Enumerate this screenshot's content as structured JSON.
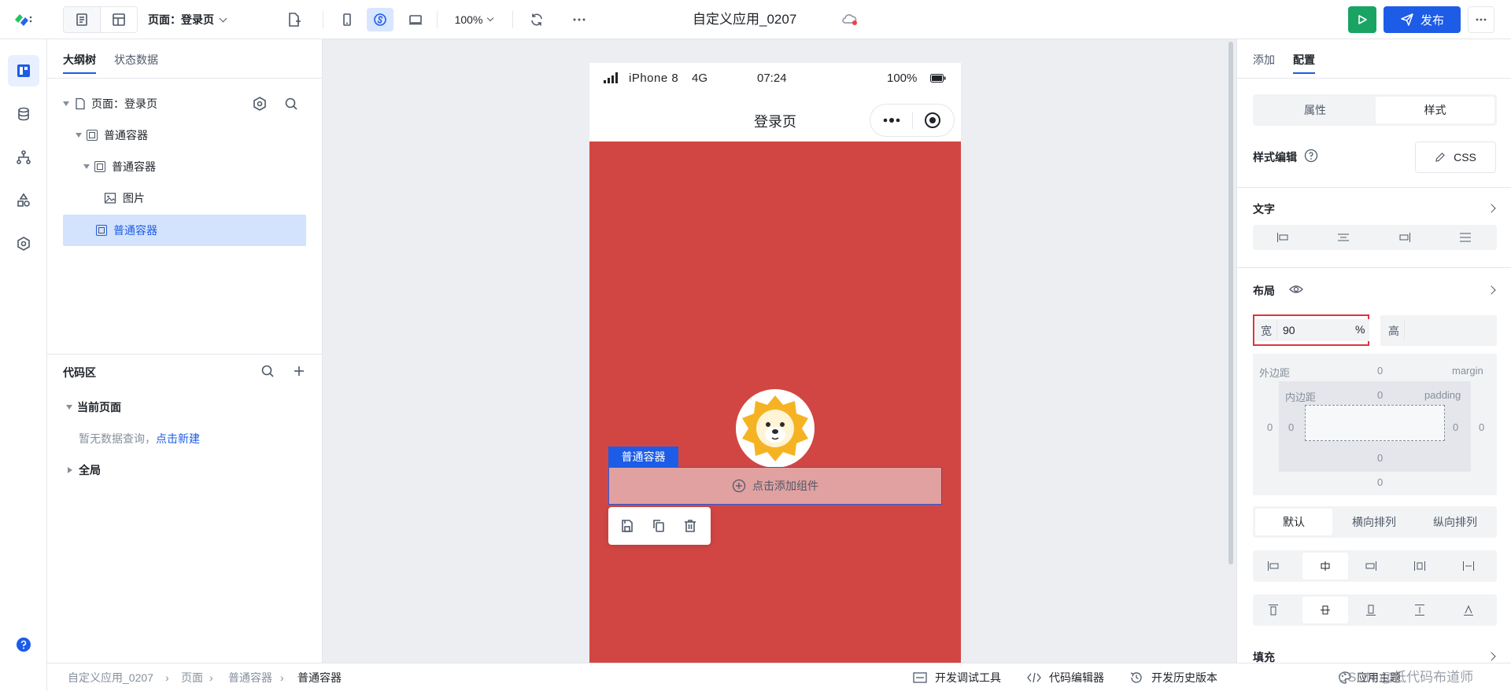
{
  "topbar": {
    "page_selector": "页面：登录页",
    "zoom": "100%",
    "app_title": "自定义应用_0207",
    "publish_label": "发布"
  },
  "outline": {
    "tabs": [
      "大纲树",
      "状态数据"
    ],
    "tree": {
      "root": "页面：登录页",
      "items": [
        "普通容器",
        "普通容器",
        "图片",
        "普通容器"
      ]
    }
  },
  "code": {
    "title": "代码区",
    "current_page": "当前页面",
    "empty_text": "暂无数据查询，",
    "create_link": "点击新建",
    "global": "全局"
  },
  "phone": {
    "carrier": "iPhone 8",
    "network": "4G",
    "time": "07:24",
    "battery": "100%",
    "nav_title": "登录页",
    "container_tag": "普通容器",
    "add_component": "点击添加组件",
    "background": "#d14643"
  },
  "right": {
    "tabs": [
      "添加",
      "配置"
    ],
    "seg": [
      "属性",
      "样式"
    ],
    "style_edit": "样式编辑",
    "css_button": "CSS",
    "text_section": "文字",
    "layout_section": "布局",
    "width_label": "宽",
    "width_value": "90",
    "width_unit": "%",
    "height_label": "高",
    "margin_label": "外边距",
    "margin_en": "margin",
    "padding_label": "内边距",
    "padding_en": "padding",
    "zero": "0",
    "layout_modes": [
      "默认",
      "横向排列",
      "纵向排列"
    ],
    "fill_section": "填充"
  },
  "breadcrumb": [
    "自定义应用_0207",
    "页面",
    "普通容器",
    "普通容器"
  ],
  "bottom_tools": [
    "开发调试工具",
    "代码编辑器",
    "开发历史版本"
  ],
  "bottom_right": {
    "theme": "应用主题",
    "watermark": "CSDN @低代码布道师"
  },
  "colors": {
    "primary": "#1d5ce6",
    "run_green": "#19a463",
    "selection": "#d3e3fd",
    "highlight_border": "#d9363e"
  }
}
